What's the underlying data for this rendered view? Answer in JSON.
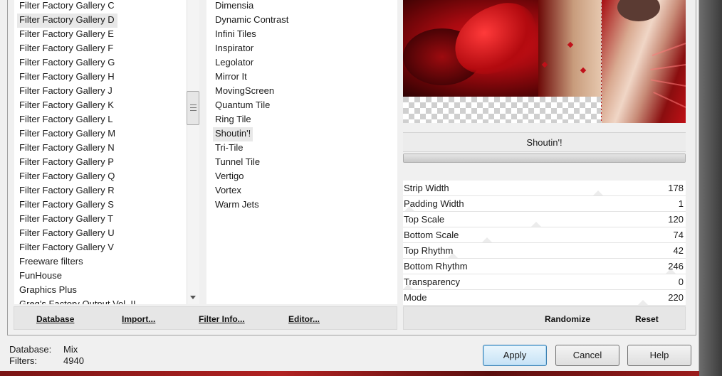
{
  "categories": {
    "items": [
      "Filter Factory Gallery C",
      "Filter Factory Gallery D",
      "Filter Factory Gallery E",
      "Filter Factory Gallery F",
      "Filter Factory Gallery G",
      "Filter Factory Gallery H",
      "Filter Factory Gallery J",
      "Filter Factory Gallery K",
      "Filter Factory Gallery L",
      "Filter Factory Gallery M",
      "Filter Factory Gallery N",
      "Filter Factory Gallery P",
      "Filter Factory Gallery Q",
      "Filter Factory Gallery R",
      "Filter Factory Gallery S",
      "Filter Factory Gallery T",
      "Filter Factory Gallery U",
      "Filter Factory Gallery V",
      "Freeware filters",
      "FunHouse",
      "Graphics Plus",
      "Greg's Factory Output Vol. II"
    ],
    "selected": "Filter Factory Gallery D"
  },
  "filters": {
    "items": [
      "Dimensia",
      "Dynamic Contrast",
      "Infini Tiles",
      "Inspirator",
      "Legolator",
      "Mirror It",
      "MovingScreen",
      "Quantum Tile",
      "Ring Tile",
      "Shoutin'!",
      "Tri-Tile",
      "Tunnel Tile",
      "Vertigo",
      "Vortex",
      "Warm Jets"
    ],
    "selected": "Shoutin'!"
  },
  "left_toolbar": {
    "database": "Database",
    "import": "Import...",
    "filter_info": "Filter Info...",
    "editor": "Editor..."
  },
  "current_filter": "Shoutin'!",
  "progress": 1.0,
  "parameters": [
    {
      "name": "Strip Width",
      "value": "178"
    },
    {
      "name": "Padding Width",
      "value": "1"
    },
    {
      "name": "Top Scale",
      "value": "120"
    },
    {
      "name": "Bottom Scale",
      "value": "74"
    },
    {
      "name": "Top Rhythm",
      "value": "42"
    },
    {
      "name": "Bottom Rhythm",
      "value": "246"
    },
    {
      "name": "Transparency",
      "value": "0"
    },
    {
      "name": "Mode",
      "value": "220"
    }
  ],
  "right_toolbar": {
    "randomize": "Randomize",
    "reset": "Reset"
  },
  "status": {
    "database_label": "Database:",
    "database_value": "Mix",
    "filters_label": "Filters:",
    "filters_value": "4940"
  },
  "buttons": {
    "apply": "Apply",
    "cancel": "Cancel",
    "help": "Help"
  },
  "colors": {
    "accent_red": "#c01016",
    "default_button_border": "#3c7fb1"
  }
}
